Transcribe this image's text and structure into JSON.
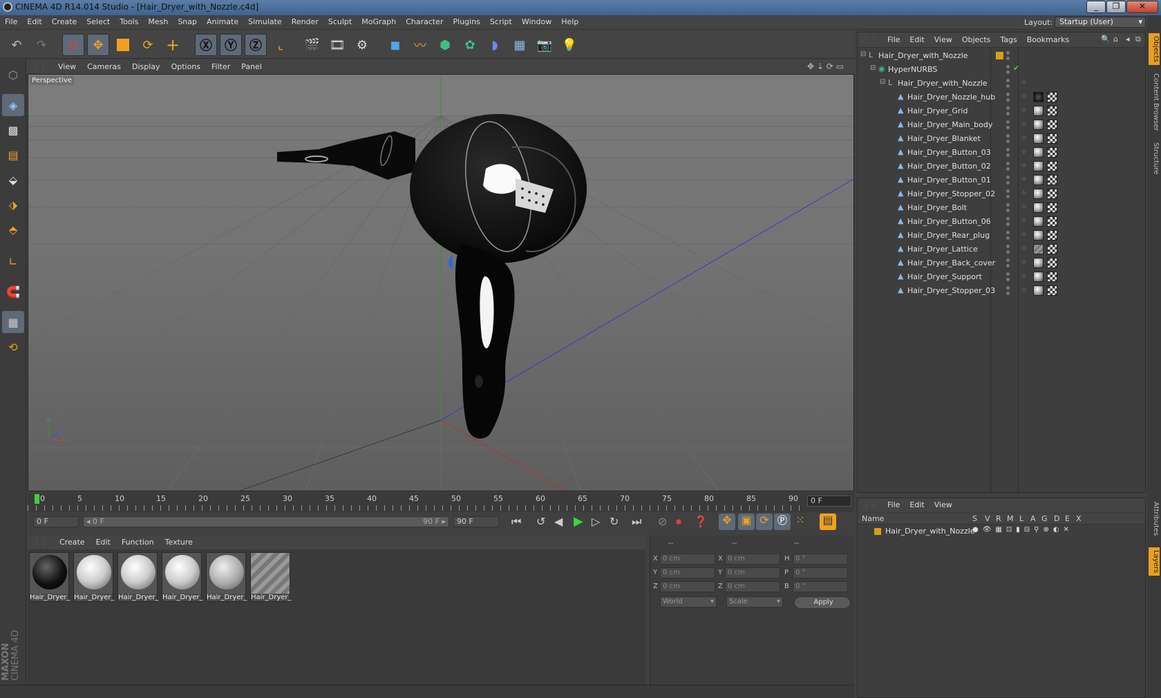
{
  "window": {
    "title": "CINEMA 4D R14.014 Studio - [Hair_Dryer_with_Nozzle.c4d]",
    "controls": [
      "_",
      "❐",
      "✕"
    ]
  },
  "menubar": [
    "File",
    "Edit",
    "Create",
    "Select",
    "Tools",
    "Mesh",
    "Snap",
    "Animate",
    "Simulate",
    "Render",
    "Sculpt",
    "MoGraph",
    "Character",
    "Plugins",
    "Script",
    "Window",
    "Help"
  ],
  "layout": {
    "label": "Layout:",
    "value": "Startup (User)"
  },
  "viewport": {
    "menu": [
      "View",
      "Cameras",
      "Display",
      "Options",
      "Filter",
      "Panel"
    ],
    "label": "Perspective",
    "axis": {
      "y": "Y",
      "z": "Z",
      "x": "X"
    }
  },
  "timeline": {
    "ticks": [
      "0",
      "5",
      "10",
      "15",
      "20",
      "25",
      "30",
      "35",
      "40",
      "45",
      "50",
      "55",
      "60",
      "65",
      "70",
      "75",
      "80",
      "85",
      "90"
    ],
    "current_frame": "0 F"
  },
  "transport": {
    "start": "0 F",
    "slider_left": "◂ 0 F",
    "slider_right": "90 F ▸",
    "end": "90 F"
  },
  "materials": {
    "menu": [
      "Create",
      "Edit",
      "Function",
      "Texture"
    ],
    "items": [
      {
        "label": "Hair_Dryer_",
        "kind": "dark"
      },
      {
        "label": "Hair_Dryer_",
        "kind": "white"
      },
      {
        "label": "Hair_Dryer_",
        "kind": "white"
      },
      {
        "label": "Hair_Dryer_",
        "kind": "white"
      },
      {
        "label": "Hair_Dryer_",
        "kind": "grey"
      },
      {
        "label": "Hair_Dryer_",
        "kind": "stripe"
      }
    ]
  },
  "coords": {
    "header": [
      "--",
      "--",
      "--"
    ],
    "rows": [
      {
        "a": "X",
        "av": "0 cm",
        "b": "X",
        "bv": "0 cm",
        "c": "H",
        "cv": "0 °"
      },
      {
        "a": "Y",
        "av": "0 cm",
        "b": "Y",
        "bv": "0 cm",
        "c": "P",
        "cv": "0 °"
      },
      {
        "a": "Z",
        "av": "0 cm",
        "b": "Z",
        "bv": "0 cm",
        "c": "B",
        "cv": "0 °"
      }
    ],
    "mode": "World",
    "scale": "Scale",
    "apply": "Apply"
  },
  "objects": {
    "menu": [
      "File",
      "Edit",
      "View",
      "Objects",
      "Tags",
      "Bookmarks"
    ],
    "tree": [
      {
        "name": "Hair_Dryer_with_Nozzle",
        "level": 0,
        "icon": "null"
      },
      {
        "name": "HyperNURBS",
        "level": 1,
        "icon": "nurbs"
      },
      {
        "name": "Hair_Dryer_with_Nozzle",
        "level": 2,
        "icon": "null"
      },
      {
        "name": "Hair_Dryer_Nozzle_hub",
        "level": 3,
        "icon": "poly"
      },
      {
        "name": "Hair_Dryer_Grid",
        "level": 3,
        "icon": "poly"
      },
      {
        "name": "Hair_Dryer_Main_body",
        "level": 3,
        "icon": "poly"
      },
      {
        "name": "Hair_Dryer_Blanket",
        "level": 3,
        "icon": "poly"
      },
      {
        "name": "Hair_Dryer_Button_03",
        "level": 3,
        "icon": "poly"
      },
      {
        "name": "Hair_Dryer_Button_02",
        "level": 3,
        "icon": "poly"
      },
      {
        "name": "Hair_Dryer_Button_01",
        "level": 3,
        "icon": "poly"
      },
      {
        "name": "Hair_Dryer_Stopper_02",
        "level": 3,
        "icon": "poly"
      },
      {
        "name": "Hair_Dryer_Bolt",
        "level": 3,
        "icon": "poly"
      },
      {
        "name": "Hair_Dryer_Button_06",
        "level": 3,
        "icon": "poly"
      },
      {
        "name": "Hair_Dryer_Rear_plug",
        "level": 3,
        "icon": "poly"
      },
      {
        "name": "Hair_Dryer_Lattice",
        "level": 3,
        "icon": "poly"
      },
      {
        "name": "Hair_Dryer_Back_cover",
        "level": 3,
        "icon": "poly"
      },
      {
        "name": "Hair_Dryer_Support",
        "level": 3,
        "icon": "poly"
      },
      {
        "name": "Hair_Dryer_Stopper_03",
        "level": 3,
        "icon": "poly"
      }
    ]
  },
  "layers": {
    "menu": [
      "File",
      "Edit",
      "View"
    ],
    "columns": [
      "Name",
      "S",
      "V",
      "R",
      "M",
      "L",
      "A",
      "G",
      "D",
      "E",
      "X"
    ],
    "rows": [
      {
        "name": "Hair_Dryer_with_Nozzle"
      }
    ]
  },
  "side_tabs": [
    "Objects",
    "Content Browser",
    "Structure",
    "Attributes",
    "Layers"
  ],
  "brand": {
    "line1": "MAXON",
    "line2": "CINEMA 4D"
  },
  "colors": {
    "accent_orange": "#e8a020",
    "toolbar_active": "#5e6a78",
    "layer_color": "#d4a017"
  }
}
